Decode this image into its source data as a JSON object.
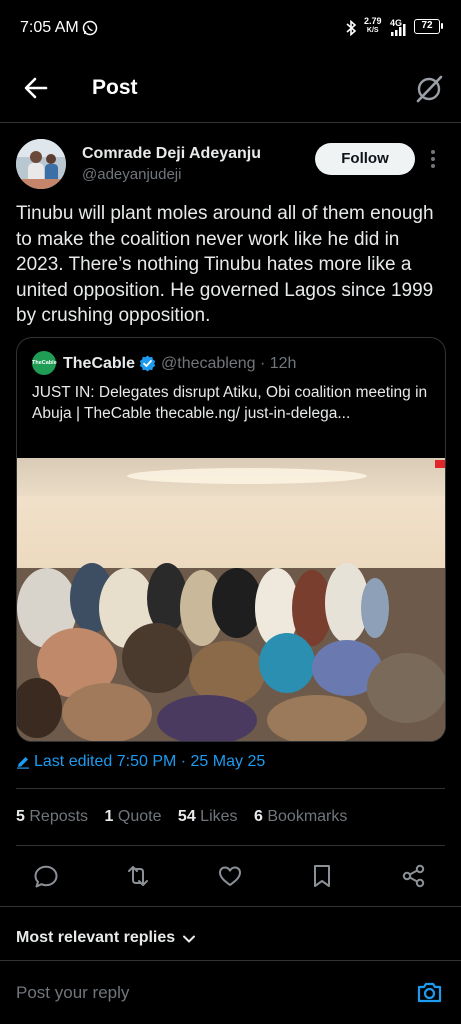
{
  "status_bar": {
    "time": "7:05 AM",
    "net_speed_value": "2.79",
    "net_speed_unit": "K/S",
    "network": "4G",
    "battery": "72"
  },
  "header": {
    "title": "Post",
    "back_icon": "arrow-left-icon",
    "grok_icon": "grok-icon"
  },
  "post": {
    "author_name": "Comrade Deji Adeyanju",
    "author_handle": "@adeyanjudeji",
    "follow_label": "Follow",
    "text": "Tinubu will plant moles around all of them enough to make the coalition never work like he did in 2023. There’s nothing Tinubu hates more like a united opposition. He governed Lagos since 1999 by crushing opposition.",
    "edited_label": "Last edited 7:50 PM · 25 May 25"
  },
  "quote": {
    "logo_text": "TheCable",
    "name": "TheCable",
    "handle_time": "@thecableng · 12h",
    "text": "JUST IN: Delegates disrupt Atiku, Obi coalition meeting in Abuja | TheCable thecable.ng/ just-in-delega..."
  },
  "stats": {
    "reposts_count": "5",
    "reposts_label": "Reposts",
    "quotes_count": "1",
    "quotes_label": "Quote",
    "likes_count": "54",
    "likes_label": "Likes",
    "bookmarks_count": "6",
    "bookmarks_label": "Bookmarks"
  },
  "actions": [
    "reply-icon",
    "repost-icon",
    "like-icon",
    "bookmark-icon",
    "share-icon"
  ],
  "replies": {
    "sort_label": "Most relevant replies",
    "reply_placeholder": "Post your reply"
  },
  "colors": {
    "background": "#000000",
    "accent": "#1d9bf0",
    "muted": "#71767b",
    "divider": "#2f3336",
    "cable_green": "#1f9d55"
  }
}
